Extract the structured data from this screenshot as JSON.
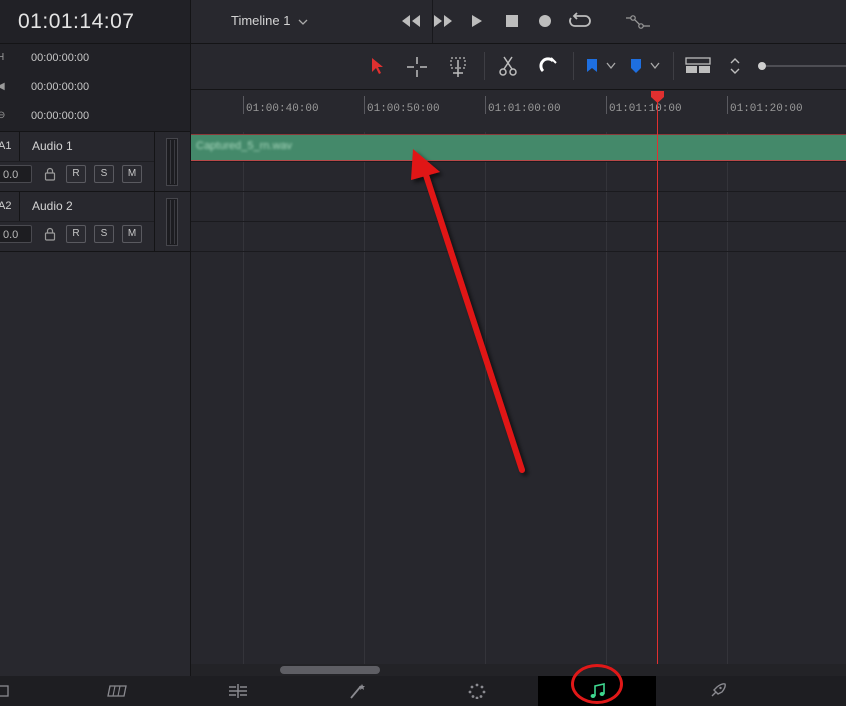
{
  "header": {
    "timecode": "01:01:14:07",
    "timeline_name": "Timeline 1",
    "timecode_rows": [
      {
        "icon": "H",
        "value": "00:00:00:00"
      },
      {
        "icon": "◀",
        "value": "00:00:00:00"
      },
      {
        "icon": "⊖",
        "value": "00:00:00:00"
      }
    ]
  },
  "tracks": [
    {
      "id": "A1",
      "name": "Audio 1",
      "volume": "0.0",
      "buttons": [
        "R",
        "S",
        "M"
      ]
    },
    {
      "id": "A2",
      "name": "Audio 2",
      "volume": "0.0",
      "buttons": [
        "R",
        "S",
        "M"
      ]
    }
  ],
  "ruler": {
    "labels": [
      "01:00:40:00",
      "01:00:50:00",
      "01:01:00:00",
      "01:01:10:00",
      "01:01:20:00"
    ]
  },
  "clip": {
    "name": "Captured_5_rn.wav",
    "color": "#44896a"
  },
  "playhead_color": "#e03030",
  "pages": [
    {
      "name": "media-page",
      "icon": "media-icon"
    },
    {
      "name": "cut-page",
      "icon": "cut-page-icon"
    },
    {
      "name": "edit-page",
      "icon": "edit-page-icon"
    },
    {
      "name": "fusion-page",
      "icon": "fusion-page-icon"
    },
    {
      "name": "color-page",
      "icon": "color-page-icon"
    },
    {
      "name": "fairlight-page",
      "icon": "music-note-icon",
      "active": true
    },
    {
      "name": "deliver-page",
      "icon": "rocket-icon"
    }
  ],
  "accent_colors": {
    "flag": "#1e6fe0",
    "select": "#e03030",
    "annotation": "#e01818"
  }
}
